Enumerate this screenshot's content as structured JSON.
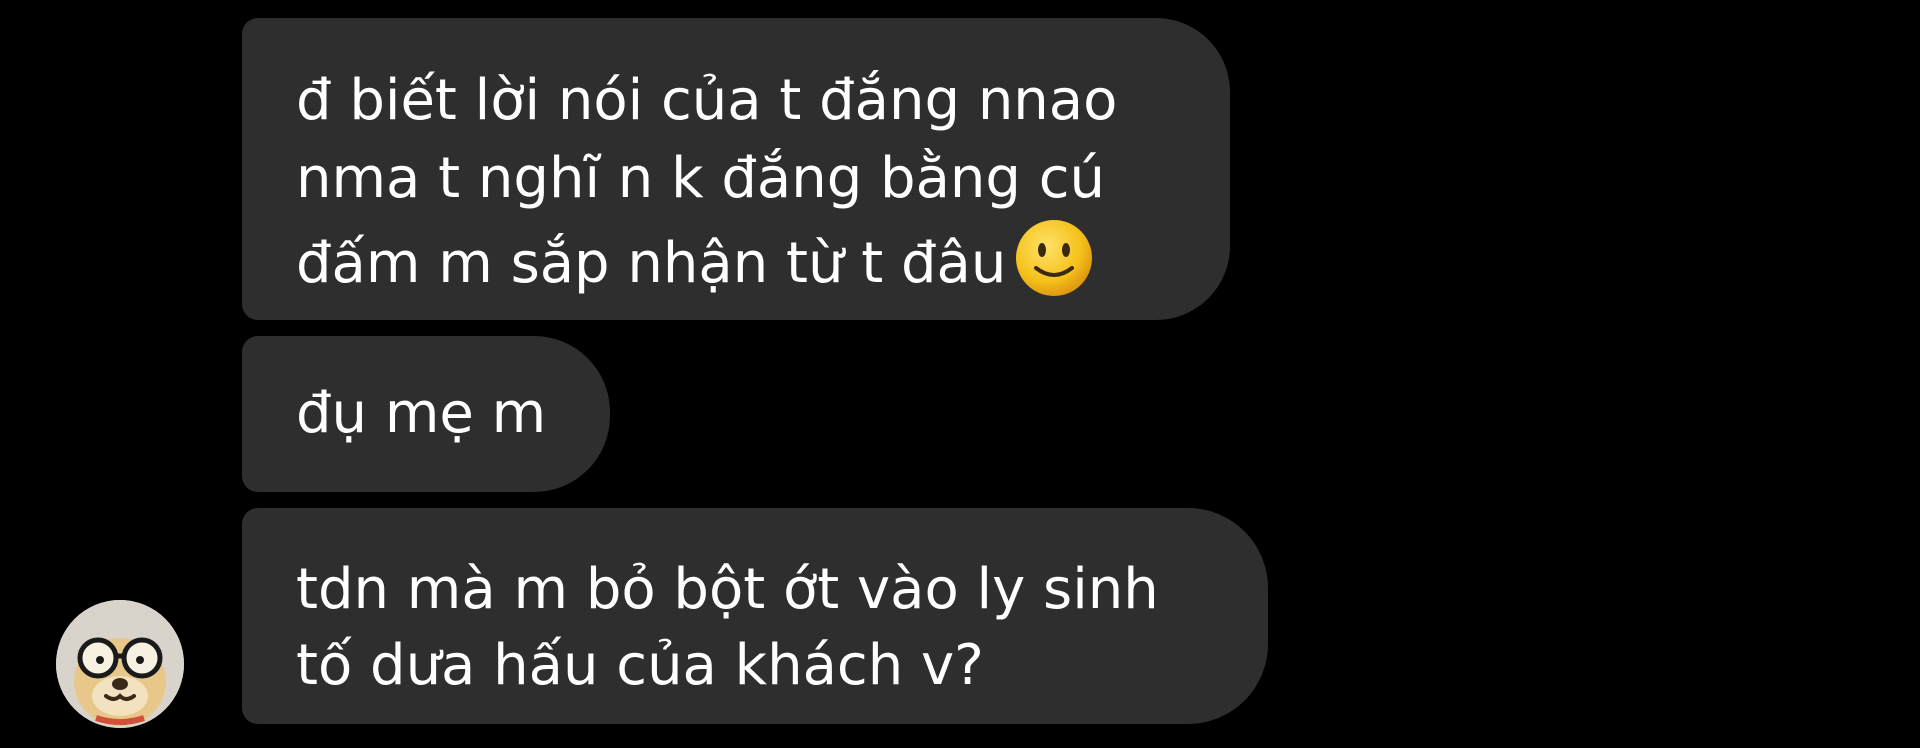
{
  "messages": [
    {
      "lines": [
        "đ biết lời nói của t đắng nnao",
        "nma t nghĩ n k đắng bằng cú",
        "đấm m sắp nhận từ t đâu"
      ],
      "emoji": "slightly-smiling-face"
    },
    {
      "lines": [
        "đụ mẹ m"
      ]
    },
    {
      "lines": [
        "tdn mà m bỏ bột ớt vào ly sinh",
        "tố dưa hấu của khách v?"
      ]
    }
  ],
  "avatar": {
    "icon": "dog-with-glasses-avatar"
  },
  "colors": {
    "background": "#000000",
    "bubble": "#2e2e2e",
    "text": "#ffffff",
    "emoji_face": "#f5c21b"
  }
}
